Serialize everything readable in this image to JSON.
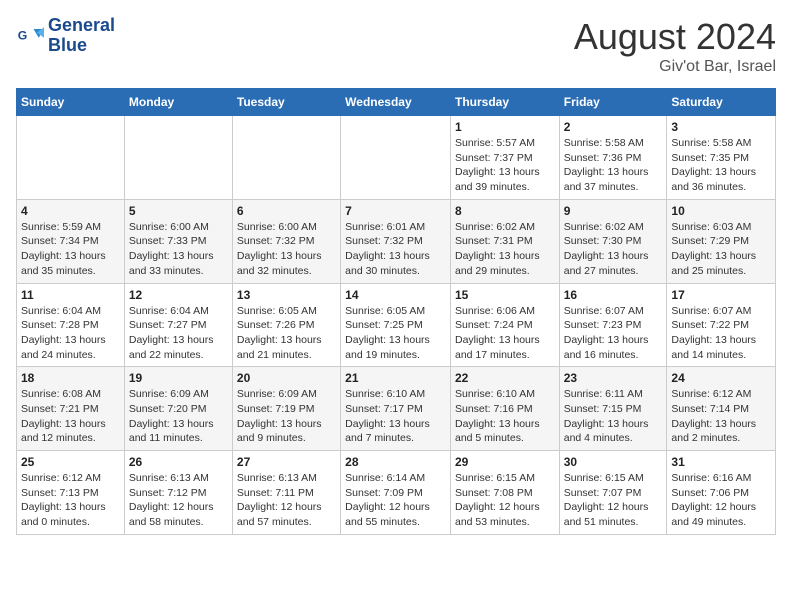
{
  "header": {
    "logo_line1": "General",
    "logo_line2": "Blue",
    "month_title": "August 2024",
    "location": "Giv'ot Bar, Israel"
  },
  "weekdays": [
    "Sunday",
    "Monday",
    "Tuesday",
    "Wednesday",
    "Thursday",
    "Friday",
    "Saturday"
  ],
  "weeks": [
    [
      {
        "day": "",
        "info": ""
      },
      {
        "day": "",
        "info": ""
      },
      {
        "day": "",
        "info": ""
      },
      {
        "day": "",
        "info": ""
      },
      {
        "day": "1",
        "info": "Sunrise: 5:57 AM\nSunset: 7:37 PM\nDaylight: 13 hours\nand 39 minutes."
      },
      {
        "day": "2",
        "info": "Sunrise: 5:58 AM\nSunset: 7:36 PM\nDaylight: 13 hours\nand 37 minutes."
      },
      {
        "day": "3",
        "info": "Sunrise: 5:58 AM\nSunset: 7:35 PM\nDaylight: 13 hours\nand 36 minutes."
      }
    ],
    [
      {
        "day": "4",
        "info": "Sunrise: 5:59 AM\nSunset: 7:34 PM\nDaylight: 13 hours\nand 35 minutes."
      },
      {
        "day": "5",
        "info": "Sunrise: 6:00 AM\nSunset: 7:33 PM\nDaylight: 13 hours\nand 33 minutes."
      },
      {
        "day": "6",
        "info": "Sunrise: 6:00 AM\nSunset: 7:32 PM\nDaylight: 13 hours\nand 32 minutes."
      },
      {
        "day": "7",
        "info": "Sunrise: 6:01 AM\nSunset: 7:32 PM\nDaylight: 13 hours\nand 30 minutes."
      },
      {
        "day": "8",
        "info": "Sunrise: 6:02 AM\nSunset: 7:31 PM\nDaylight: 13 hours\nand 29 minutes."
      },
      {
        "day": "9",
        "info": "Sunrise: 6:02 AM\nSunset: 7:30 PM\nDaylight: 13 hours\nand 27 minutes."
      },
      {
        "day": "10",
        "info": "Sunrise: 6:03 AM\nSunset: 7:29 PM\nDaylight: 13 hours\nand 25 minutes."
      }
    ],
    [
      {
        "day": "11",
        "info": "Sunrise: 6:04 AM\nSunset: 7:28 PM\nDaylight: 13 hours\nand 24 minutes."
      },
      {
        "day": "12",
        "info": "Sunrise: 6:04 AM\nSunset: 7:27 PM\nDaylight: 13 hours\nand 22 minutes."
      },
      {
        "day": "13",
        "info": "Sunrise: 6:05 AM\nSunset: 7:26 PM\nDaylight: 13 hours\nand 21 minutes."
      },
      {
        "day": "14",
        "info": "Sunrise: 6:05 AM\nSunset: 7:25 PM\nDaylight: 13 hours\nand 19 minutes."
      },
      {
        "day": "15",
        "info": "Sunrise: 6:06 AM\nSunset: 7:24 PM\nDaylight: 13 hours\nand 17 minutes."
      },
      {
        "day": "16",
        "info": "Sunrise: 6:07 AM\nSunset: 7:23 PM\nDaylight: 13 hours\nand 16 minutes."
      },
      {
        "day": "17",
        "info": "Sunrise: 6:07 AM\nSunset: 7:22 PM\nDaylight: 13 hours\nand 14 minutes."
      }
    ],
    [
      {
        "day": "18",
        "info": "Sunrise: 6:08 AM\nSunset: 7:21 PM\nDaylight: 13 hours\nand 12 minutes."
      },
      {
        "day": "19",
        "info": "Sunrise: 6:09 AM\nSunset: 7:20 PM\nDaylight: 13 hours\nand 11 minutes."
      },
      {
        "day": "20",
        "info": "Sunrise: 6:09 AM\nSunset: 7:19 PM\nDaylight: 13 hours\nand 9 minutes."
      },
      {
        "day": "21",
        "info": "Sunrise: 6:10 AM\nSunset: 7:17 PM\nDaylight: 13 hours\nand 7 minutes."
      },
      {
        "day": "22",
        "info": "Sunrise: 6:10 AM\nSunset: 7:16 PM\nDaylight: 13 hours\nand 5 minutes."
      },
      {
        "day": "23",
        "info": "Sunrise: 6:11 AM\nSunset: 7:15 PM\nDaylight: 13 hours\nand 4 minutes."
      },
      {
        "day": "24",
        "info": "Sunrise: 6:12 AM\nSunset: 7:14 PM\nDaylight: 13 hours\nand 2 minutes."
      }
    ],
    [
      {
        "day": "25",
        "info": "Sunrise: 6:12 AM\nSunset: 7:13 PM\nDaylight: 13 hours\nand 0 minutes."
      },
      {
        "day": "26",
        "info": "Sunrise: 6:13 AM\nSunset: 7:12 PM\nDaylight: 12 hours\nand 58 minutes."
      },
      {
        "day": "27",
        "info": "Sunrise: 6:13 AM\nSunset: 7:11 PM\nDaylight: 12 hours\nand 57 minutes."
      },
      {
        "day": "28",
        "info": "Sunrise: 6:14 AM\nSunset: 7:09 PM\nDaylight: 12 hours\nand 55 minutes."
      },
      {
        "day": "29",
        "info": "Sunrise: 6:15 AM\nSunset: 7:08 PM\nDaylight: 12 hours\nand 53 minutes."
      },
      {
        "day": "30",
        "info": "Sunrise: 6:15 AM\nSunset: 7:07 PM\nDaylight: 12 hours\nand 51 minutes."
      },
      {
        "day": "31",
        "info": "Sunrise: 6:16 AM\nSunset: 7:06 PM\nDaylight: 12 hours\nand 49 minutes."
      }
    ]
  ]
}
